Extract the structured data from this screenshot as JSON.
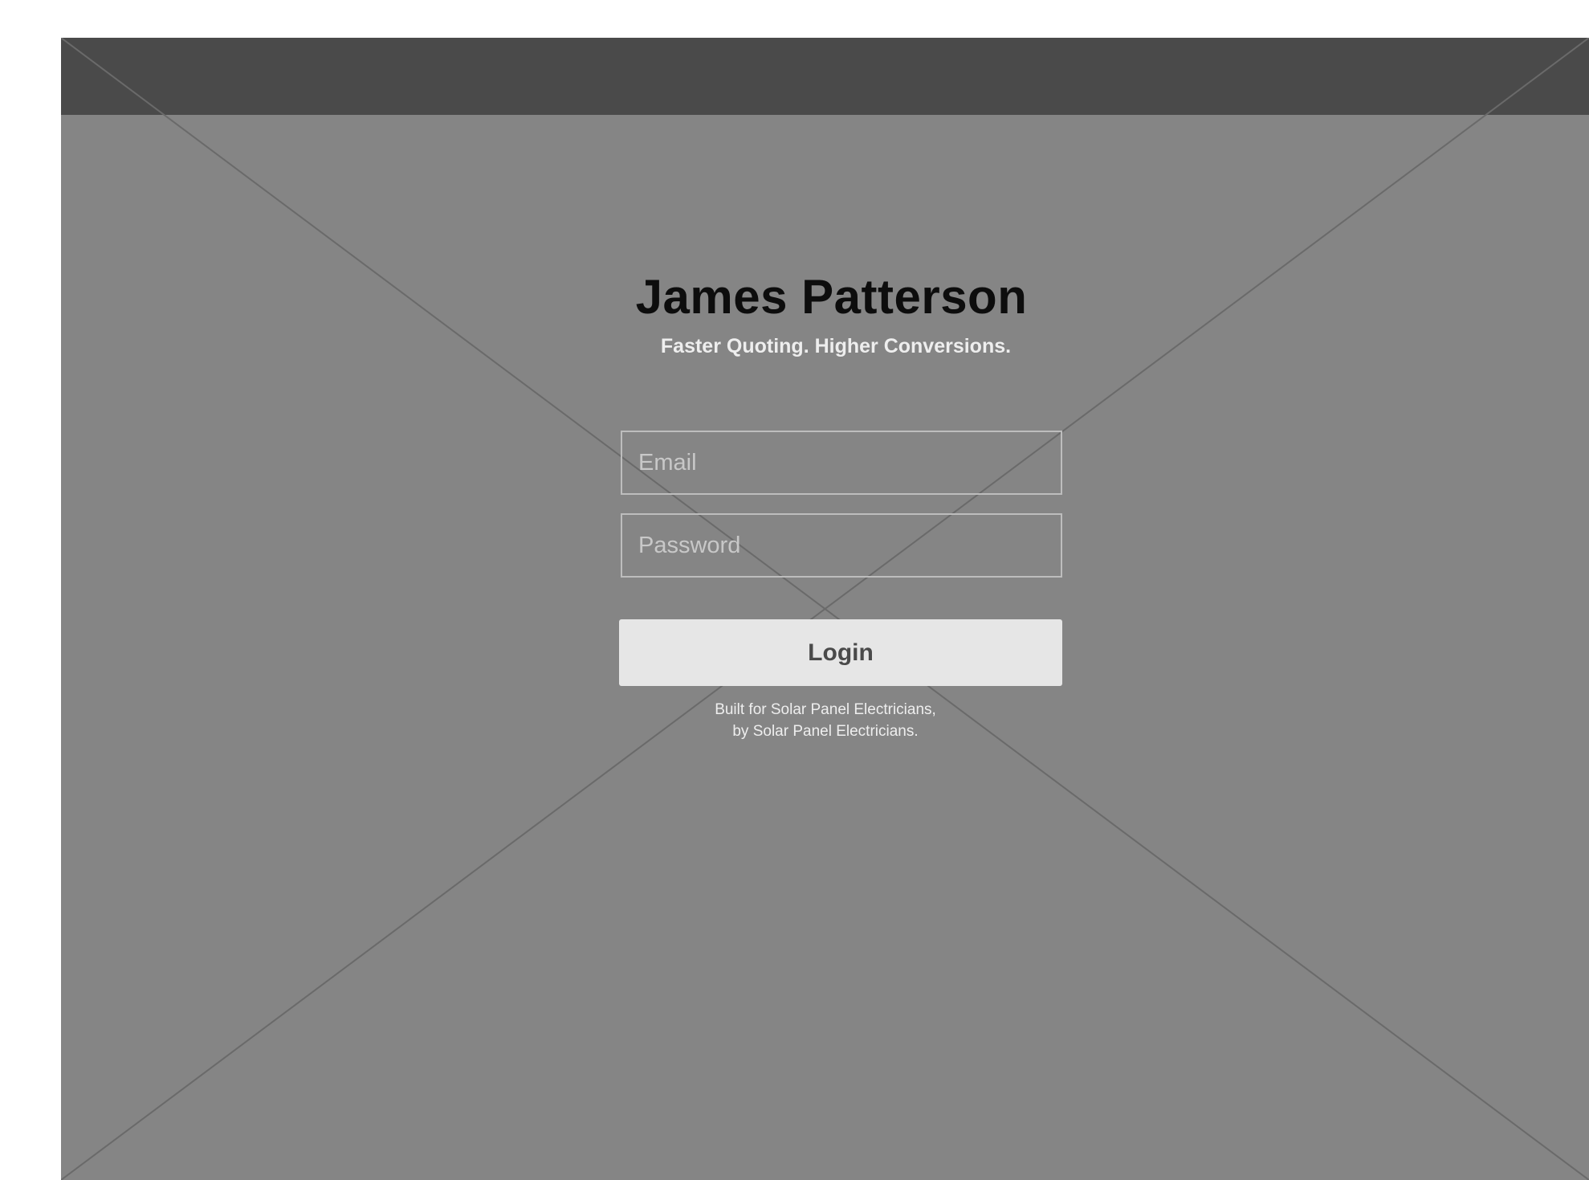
{
  "login": {
    "title": "James Patterson",
    "tagline": "Faster Quoting. Higher Conversions.",
    "email_placeholder": "Email",
    "password_placeholder": "Password",
    "login_label": "Login",
    "footnote_line1": "Built for Solar Panel Electricians,",
    "footnote_line2": "by Solar Panel Electricians."
  },
  "colors": {
    "page_background": "#ffffff",
    "frame_background": "#858585",
    "top_bar": "#4a4a4a",
    "button_background": "#e6e6e6",
    "button_text": "#4a4a4a",
    "title_text": "#0d0d0d"
  }
}
